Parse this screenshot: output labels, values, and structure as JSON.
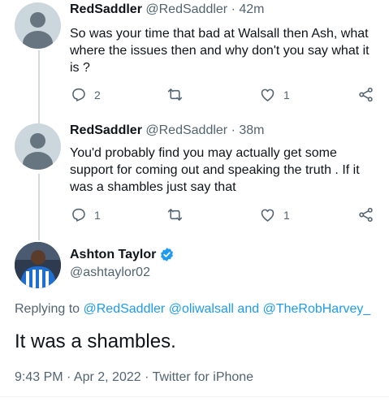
{
  "tweets": [
    {
      "name": "RedSaddler",
      "handle": "@RedSaddler",
      "separator": "·",
      "time": "42m",
      "text": "So was your time that bad at Walsall then Ash, what where the issues then and why don't you say what it is ?",
      "replies": "2",
      "retweets": "",
      "likes": "1"
    },
    {
      "name": "RedSaddler",
      "handle": "@RedSaddler",
      "separator": "·",
      "time": "38m",
      "text": "You'd probably find you may actually get some support for coming out and speaking the truth . If it was a shambles just say that",
      "replies": "1",
      "retweets": "",
      "likes": "1"
    }
  ],
  "main_tweet": {
    "name": "Ashton Taylor",
    "handle": "@ashtaylor02",
    "replying_prefix": "Replying to",
    "mention_1": "@RedSaddler",
    "mention_2": "@oliwalsall",
    "conjunction": "and",
    "mention_3": "@TheRobHarvey_",
    "text": "It was a shambles.",
    "timestamp": "9:43 PM · Apr 2, 2022 · Twitter for iPhone"
  },
  "colors": {
    "accent": "#1d9bf0",
    "secondary_text": "#536471",
    "primary_text": "#0f1419",
    "thread_line": "#cfd9de"
  },
  "icons": [
    "default-avatar-icon",
    "reply-icon",
    "retweet-icon",
    "like-icon",
    "share-icon",
    "verified-badge-icon"
  ]
}
